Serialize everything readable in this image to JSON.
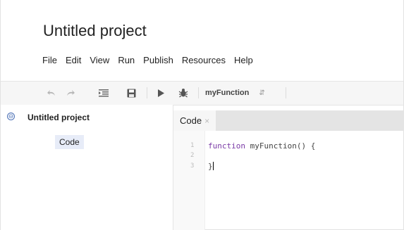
{
  "project": {
    "title": "Untitled project"
  },
  "menu": {
    "items": [
      "File",
      "Edit",
      "View",
      "Run",
      "Publish",
      "Resources",
      "Help"
    ]
  },
  "toolbar": {
    "icons": [
      "undo-icon",
      "redo-icon",
      "indent-icon",
      "save-icon",
      "run-icon",
      "debug-icon"
    ],
    "function_select": "myFunction"
  },
  "sidebar": {
    "root_label": "Untitled project",
    "toggle_symbol": "⊖",
    "files": [
      {
        "label": "Code",
        "selected": true
      }
    ]
  },
  "editor": {
    "tab_label": "Code",
    "tab_close": "×",
    "line_numbers": [
      "1",
      "2",
      "3"
    ],
    "lines": {
      "keyword": "function",
      "signature": " myFunction() {",
      "blank": "",
      "closing": "}"
    }
  },
  "colors": {
    "keyword": "#7a3aa6",
    "selected_file": "#e7ecf8",
    "toolbar_bg": "#f6f6f6"
  }
}
